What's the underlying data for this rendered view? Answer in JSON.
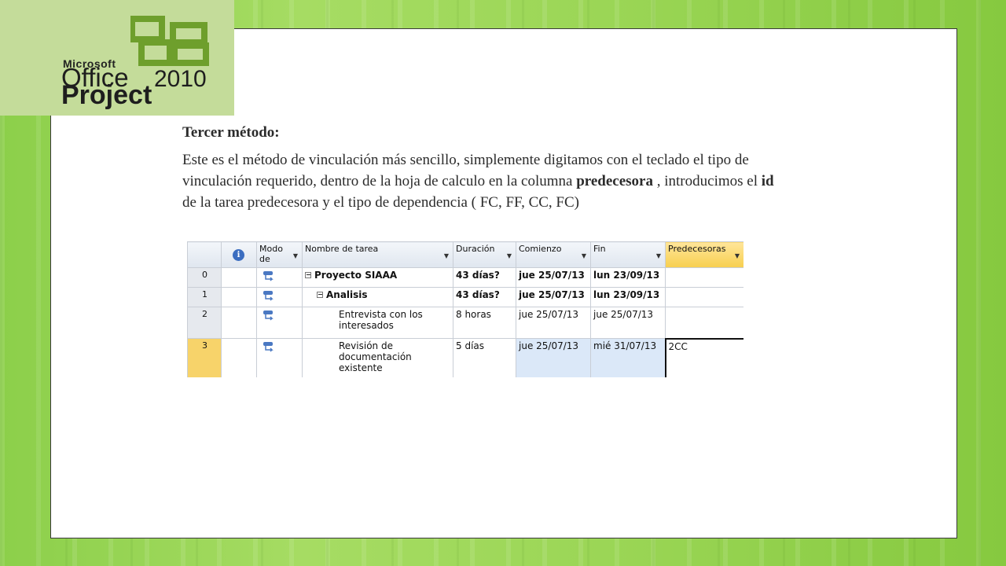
{
  "logo": {
    "brand": "Microsoft",
    "product_line": "Office",
    "year": "2010",
    "product": "Project"
  },
  "slide": {
    "heading": "Tercer método:",
    "paragraph": {
      "part1": "Este es el método de vinculación más sencillo, simplemente digitamos con el teclado el tipo de vinculación requerido, dentro de la hoja de calculo en la columna ",
      "bold1": "predecesora",
      "part2": " , introducimos el ",
      "bold2": "id",
      "part3": "  de la tarea predecesora y el tipo de dependencia ( FC, FF, CC, FC)"
    }
  },
  "sheet": {
    "headers": {
      "mode": "Modo de",
      "name": "Nombre de tarea",
      "duration": "Duración",
      "start": "Comienzo",
      "finish": "Fin",
      "predecessors": "Predecesoras"
    },
    "icons": {
      "info": "info-icon",
      "mode": "auto-schedule-icon",
      "collapse": "collapse-icon"
    },
    "rows": [
      {
        "id": "0",
        "name": "Proyecto SIAAA",
        "duration": "43 días?",
        "start": "jue 25/07/13",
        "finish": "lun 23/09/13",
        "pred": ""
      },
      {
        "id": "1",
        "name": "Analisis",
        "duration": "43 días?",
        "start": "jue 25/07/13",
        "finish": "lun 23/09/13",
        "pred": ""
      },
      {
        "id": "2",
        "name": "Entrevista con los interesados",
        "duration": "8 horas",
        "start": "jue 25/07/13",
        "finish": "jue 25/07/13",
        "pred": ""
      },
      {
        "id": "3",
        "name": "Revisión de documentación existente",
        "duration": "5 días",
        "start": "jue 25/07/13",
        "finish": "mié 31/07/13",
        "pred": "2CC"
      }
    ]
  }
}
